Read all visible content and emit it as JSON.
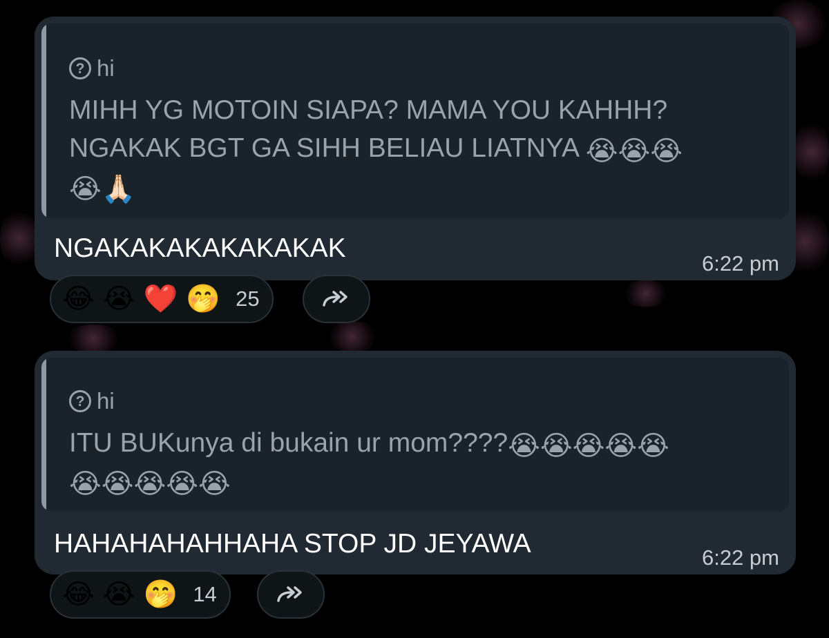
{
  "messages": [
    {
      "quote": {
        "sender": "hi",
        "lines": [
          "MIHH YG MOTOIN SIAPA? MAMA YOU KAHHH?",
          "NGAKAK BGT GA SIHH BELIAU LIATNYA"
        ],
        "line2_emojis": "😭😭😭",
        "line3_emojis": "😭🙏🏻"
      },
      "text": "NGAKAKAKAKAKAKAK",
      "time": "6:22 pm",
      "reactions": [
        "😂",
        "😭",
        "❤️",
        "🤭"
      ],
      "reaction_count": "25"
    },
    {
      "quote": {
        "sender": "hi",
        "lines": [
          "ITU BUKunya di bukain ur mom????"
        ],
        "line1_emojis": "😭😭😭😭😭",
        "line2_emojis": "😭😭😭😭😭"
      },
      "text": "HAHAHAHAHHAHA STOP JD JEYAWA",
      "time": "6:22 pm",
      "reactions": [
        "😂",
        "😭",
        "🤭"
      ],
      "reaction_count": "14"
    }
  ],
  "icons": {
    "quote_sender_icon": "question-circle-icon",
    "forward_icon": "double-forward-arrow-icon"
  },
  "colors": {
    "background": "#000000",
    "bubble": "#212a32",
    "quote_block": "#1b232a",
    "quote_bar": "#8e99a3",
    "quote_text": "#9aa3ab",
    "message_text": "#ffffff",
    "time_text": "#c7cdd2"
  }
}
